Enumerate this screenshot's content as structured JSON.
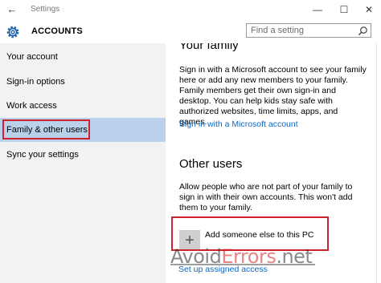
{
  "window": {
    "title": "Settings",
    "controls": {
      "minimize": "—",
      "maximize": "☐",
      "close": "✕"
    }
  },
  "header": {
    "title": "ACCOUNTS",
    "icon": "gear-icon"
  },
  "search": {
    "placeholder": "Find a setting",
    "icon": "search-icon"
  },
  "sidebar": {
    "items": [
      {
        "label": "Your account",
        "selected": false
      },
      {
        "label": "Sign-in options",
        "selected": false
      },
      {
        "label": "Work access",
        "selected": false
      },
      {
        "label": "Family & other users",
        "selected": true
      },
      {
        "label": "Sync your settings",
        "selected": false
      }
    ]
  },
  "main": {
    "family": {
      "heading": "Your family",
      "text": "Sign in with a Microsoft account to see your family here or add any new members to your family. Family members get their own sign-in and desktop. You can help kids stay safe with authorized websites, time limits, apps, and games.",
      "link": "Sign in with a Microsoft account"
    },
    "other": {
      "heading": "Other users",
      "text": "Allow people who are not part of your family to sign in with their own accounts. This won't add them to your family.",
      "add_label": "Add someone else to this PC",
      "add_icon": "plus-icon",
      "assigned_link": "Set up assigned access"
    }
  },
  "watermark": {
    "part1": "Avoid",
    "part2": "Errors",
    "part3": ".net"
  },
  "colors": {
    "accent_link": "#0a68c4",
    "selection": "#b9d1ea",
    "highlight_box": "#d0222c",
    "sidebar_bg": "#f2f2f2"
  }
}
